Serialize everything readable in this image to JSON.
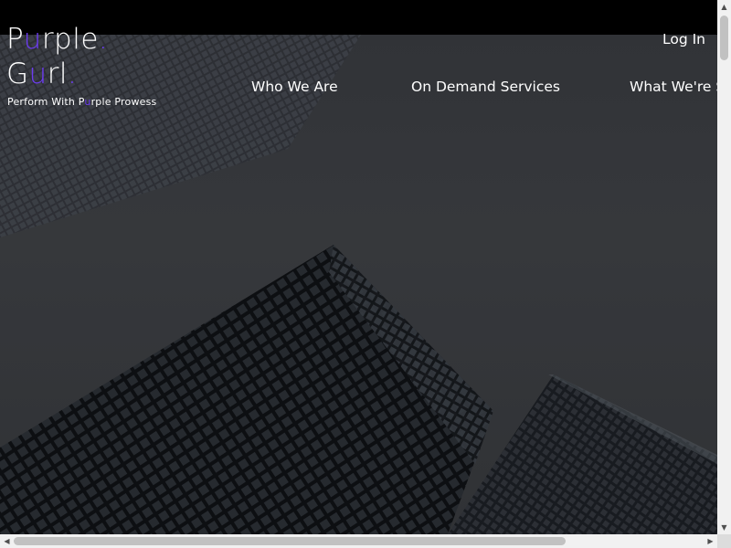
{
  "brand": {
    "line1_parts": [
      "P",
      "u",
      "rple",
      "."
    ],
    "line2_parts": [
      "G",
      "u",
      "rl",
      "."
    ],
    "tagline_parts": [
      "Perform With P",
      "u",
      "rple Prowess"
    ],
    "accent_color": "#6c3cf0"
  },
  "header": {
    "login_label": "Log In"
  },
  "nav": {
    "items": [
      {
        "label": "Who We Are"
      },
      {
        "label": "On Demand Services"
      },
      {
        "label": "What We're S"
      }
    ]
  },
  "hero": {
    "background": "skyscrapers-photo",
    "overlay_color": "#36383c"
  },
  "scrollbars": {
    "vertical": {
      "up_icon": "▲",
      "down_icon": "▼"
    },
    "horizontal": {
      "left_icon": "◀",
      "right_icon": "▶"
    }
  }
}
